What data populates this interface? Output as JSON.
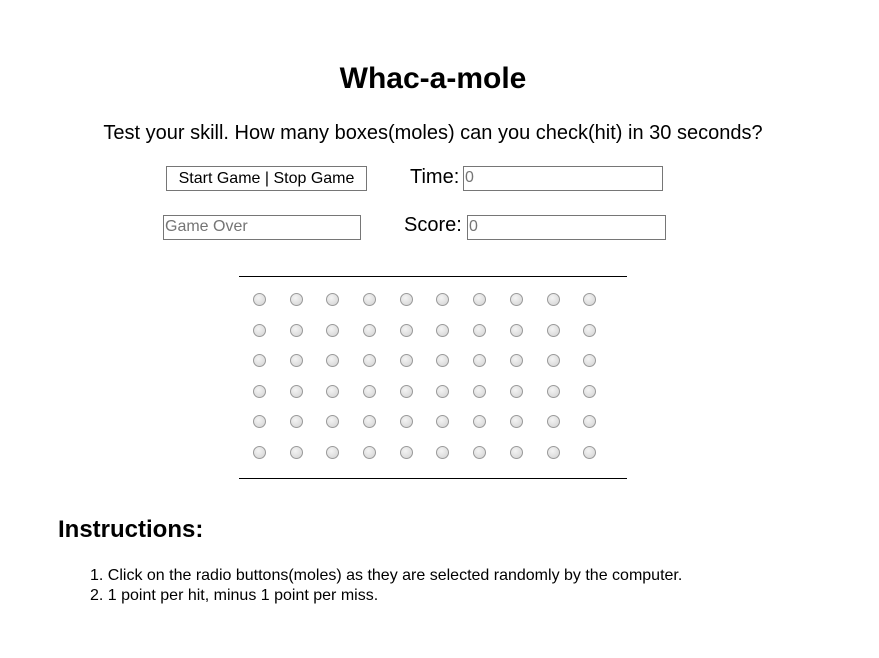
{
  "game": {
    "title": "Whac-a-mole",
    "subtitle": "Test your skill. How many boxes(moles) can you check(hit) in 30 seconds?"
  },
  "controls": {
    "start_stop_label": "Start Game | Stop Game",
    "time_label": "Time:",
    "time_placeholder": "0",
    "status_placeholder": "Game Over",
    "score_label": "Score:",
    "score_placeholder": "0"
  },
  "board": {
    "rows": 6,
    "columns": 10,
    "selected": []
  },
  "instructions": {
    "heading": "Instructions:",
    "items": [
      "1. Click on the radio buttons(moles) as they are selected randomly by the computer.",
      "2. 1 point per hit, minus 1 point per miss."
    ]
  }
}
